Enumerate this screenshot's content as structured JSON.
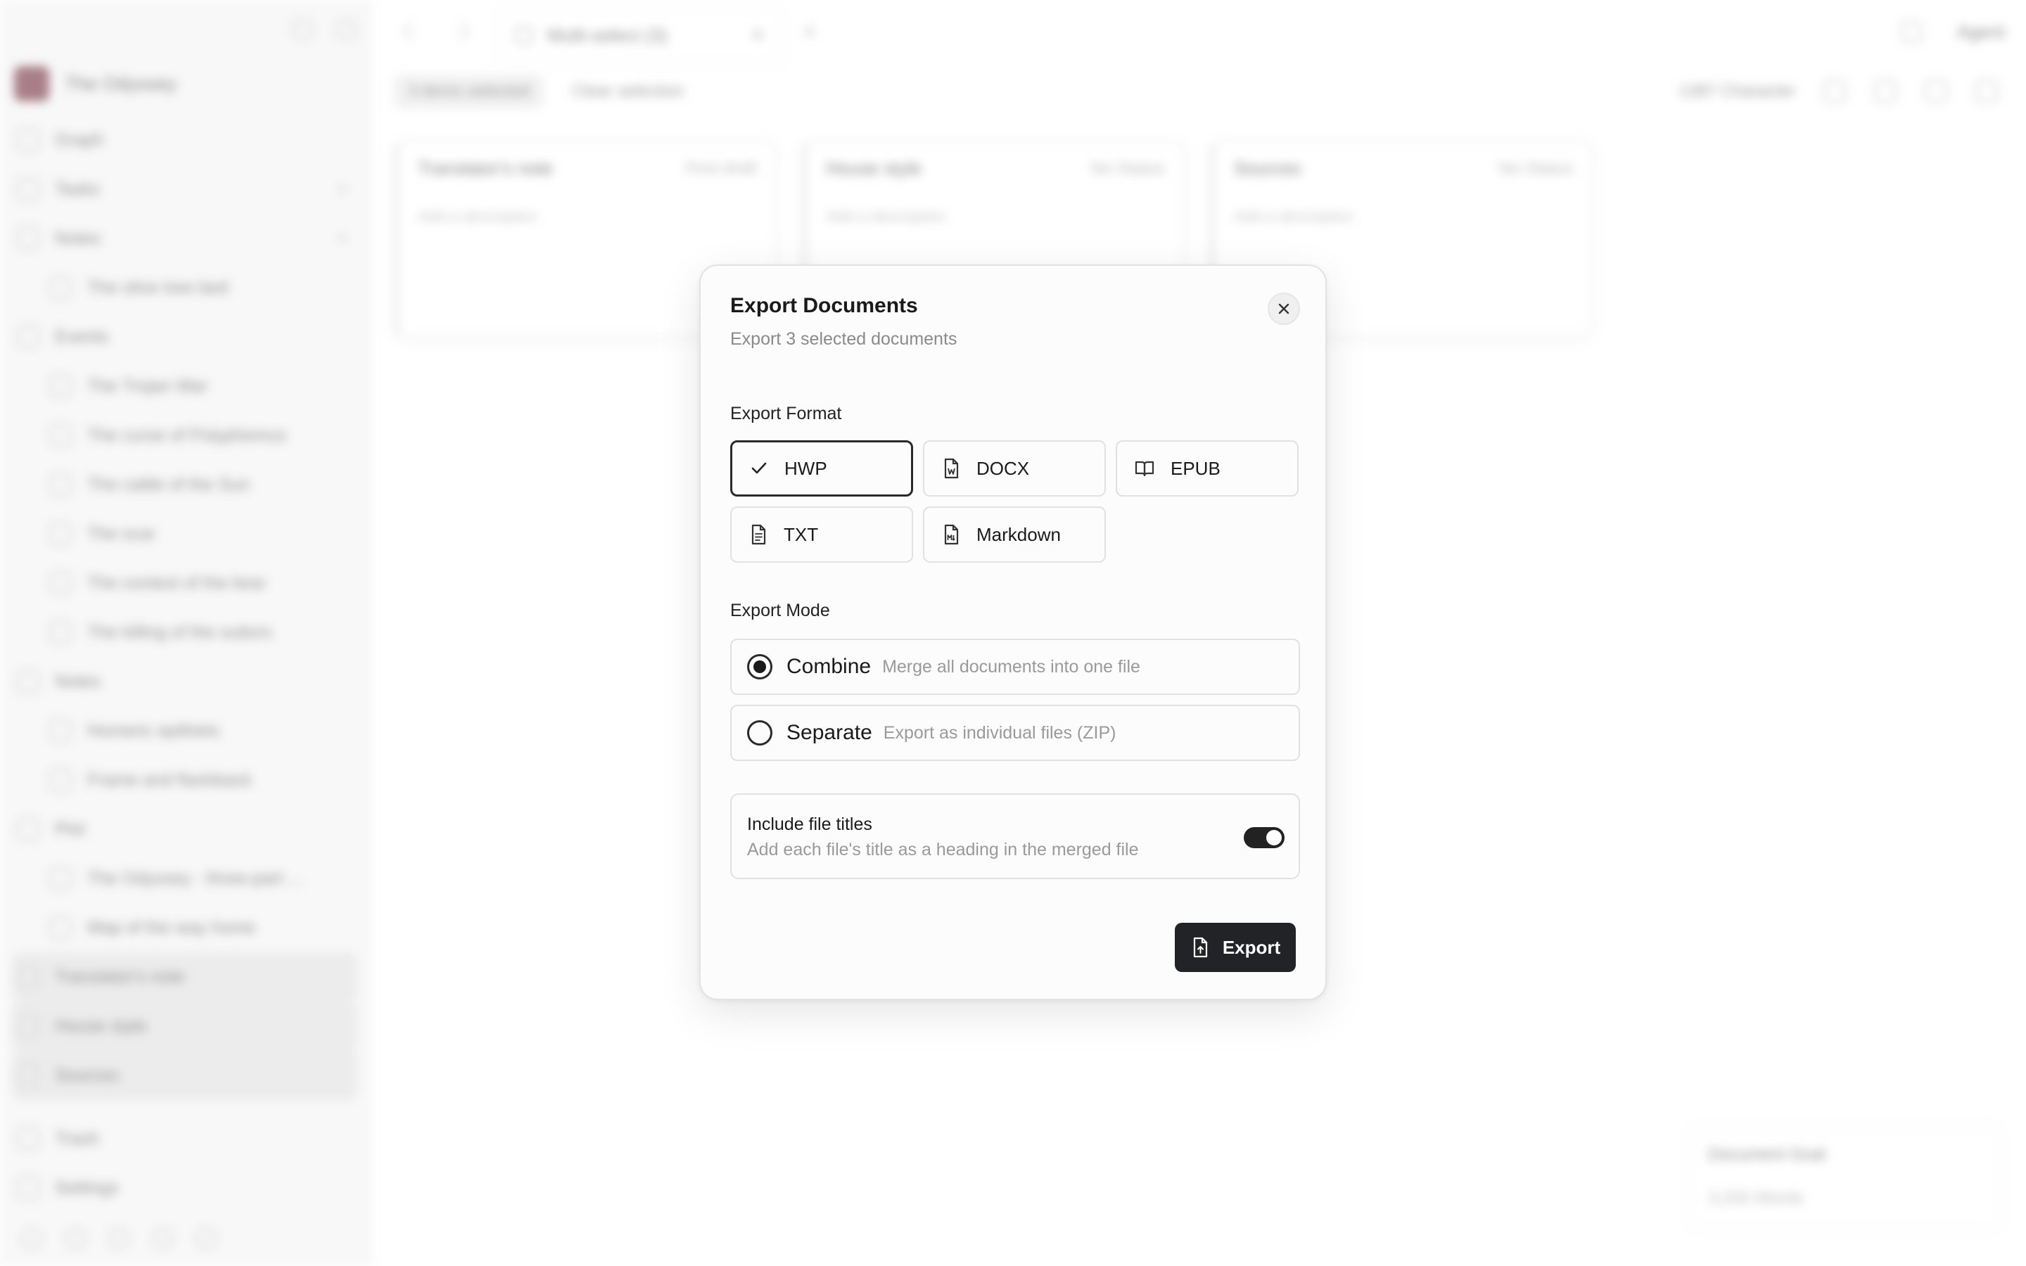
{
  "background": {
    "workspace": {
      "name": "The Odyssey"
    },
    "sidebar": {
      "items": [
        {
          "label": "Graph",
          "child": false
        },
        {
          "label": "Tasks",
          "child": false,
          "trail": "+"
        },
        {
          "label": "Notes",
          "child": false,
          "trail": "+"
        },
        {
          "label": "The olive tree bed",
          "child": true
        },
        {
          "label": "Events",
          "child": false
        },
        {
          "label": "The Trojan War",
          "child": true
        },
        {
          "label": "The curse of Polyphemus",
          "child": true
        },
        {
          "label": "The cattle of the Sun",
          "child": true
        },
        {
          "label": "The scar",
          "child": true
        },
        {
          "label": "The contest of the bow",
          "child": true
        },
        {
          "label": "The killing of the suitors",
          "child": true
        },
        {
          "label": "Notes",
          "child": false
        },
        {
          "label": "Homeric epithets",
          "child": true
        },
        {
          "label": "Frame and flashback",
          "child": true
        },
        {
          "label": "Plot",
          "child": false
        },
        {
          "label": "The Odyssey - three-part ...",
          "child": true
        },
        {
          "label": "Map of the way home",
          "child": true
        },
        {
          "label": "Translator's note",
          "child": false,
          "selected": true
        },
        {
          "label": "House style",
          "child": false,
          "selected": true
        },
        {
          "label": "Sources",
          "child": false,
          "selected": true
        },
        {
          "label": "Trash",
          "child": false
        },
        {
          "label": "Settings",
          "child": false
        }
      ]
    },
    "tab": {
      "label": "Multi-select (3)"
    },
    "top_right": {
      "agent_label": "Agent"
    },
    "toolbar": {
      "selected_label": "3 items selected",
      "clear_label": "Clear selection",
      "character_label": "1387 Character"
    },
    "cards": [
      {
        "title": "Translator's note",
        "status": "First draft",
        "desc": "Add a description"
      },
      {
        "title": "House style",
        "status": "No Status",
        "desc": "Add a description"
      },
      {
        "title": "Sources",
        "status": "No Status",
        "desc": "Add a description"
      }
    ],
    "goal": {
      "title": "Document Goal",
      "value": "3,200 Words"
    }
  },
  "modal": {
    "title": "Export Documents",
    "subtitle": "Export 3 selected documents",
    "close_icon": "close-icon",
    "format_label": "Export Format",
    "formats": [
      {
        "label": "HWP",
        "icon": "check-icon",
        "selected": true
      },
      {
        "label": "DOCX",
        "icon": "word-file-icon",
        "selected": false
      },
      {
        "label": "EPUB",
        "icon": "book-open-icon",
        "selected": false
      },
      {
        "label": "TXT",
        "icon": "text-file-icon",
        "selected": false
      },
      {
        "label": "Markdown",
        "icon": "markdown-file-icon",
        "selected": false
      }
    ],
    "mode_label": "Export Mode",
    "modes": [
      {
        "name": "Combine",
        "desc": "Merge all documents into one file",
        "selected": true
      },
      {
        "name": "Separate",
        "desc": "Export as individual files (ZIP)",
        "selected": false
      }
    ],
    "include_titles": {
      "title": "Include file titles",
      "desc": "Add each file's title as a heading in the merged file",
      "enabled": true
    },
    "export_button": {
      "label": "Export",
      "icon": "file-export-icon"
    }
  },
  "colors": {
    "primary": "#222326",
    "border": "#e1e1e1",
    "muted_text": "#9a9a9a",
    "overlay": "#ffffff"
  }
}
